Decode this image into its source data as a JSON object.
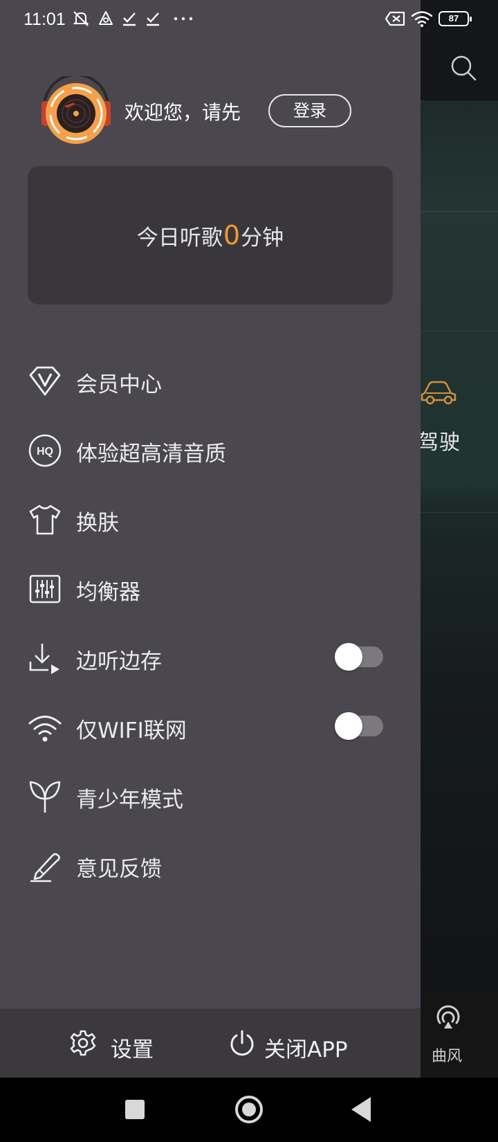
{
  "status_bar": {
    "time": "11:01",
    "battery": "87",
    "icons": [
      "mute-icon",
      "drive-icon",
      "check-icon",
      "check-icon",
      "more-dots-icon",
      "sim-error-icon",
      "wifi-icon",
      "battery-icon"
    ]
  },
  "background": {
    "drive_label": "驾驶",
    "bottom_tab_label": "曲风"
  },
  "profile": {
    "welcome": "欢迎您，请先",
    "login_label": "登录"
  },
  "listen_card": {
    "prefix": "今日听歌",
    "minutes": "0",
    "suffix": "分钟",
    "accent_color": "#f39a2c"
  },
  "menu": [
    {
      "label": "会员中心",
      "icon": "vip-diamond-icon"
    },
    {
      "label": "体验超高清音质",
      "icon": "hq-icon"
    },
    {
      "label": "换肤",
      "icon": "tshirt-icon"
    },
    {
      "label": "均衡器",
      "icon": "equalizer-icon"
    },
    {
      "label": "边听边存",
      "icon": "download-icon",
      "toggle": false
    },
    {
      "label": "仅WIFI联网",
      "icon": "wifi-icon",
      "toggle": false
    },
    {
      "label": "青少年模式",
      "icon": "sprout-icon"
    },
    {
      "label": "意见反馈",
      "icon": "pen-icon"
    }
  ],
  "footer": {
    "settings_label": "设置",
    "close_label": "关闭APP"
  },
  "colors": {
    "drawer_bg": "#4a484e",
    "card_bg": "#39373c",
    "footer_bg": "#3b393e"
  }
}
